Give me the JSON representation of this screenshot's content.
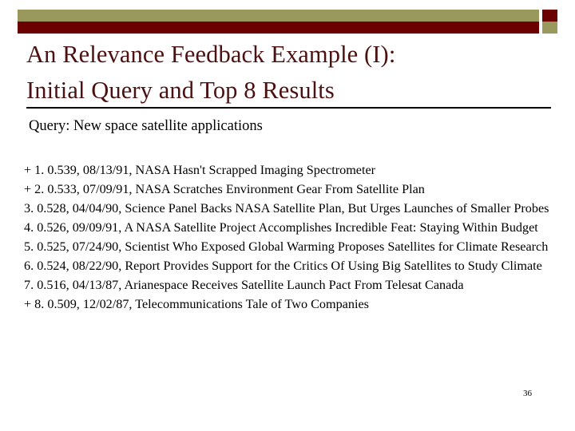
{
  "slide": {
    "title": "An Relevance Feedback Example (I):\nInitial Query and Top 8 Results",
    "title_line_1": "An Relevance Feedback Example (I):",
    "title_line_2": "Initial Query and Top 8 Results",
    "page_number": "36"
  },
  "colors": {
    "accent_olive": "#99995e",
    "accent_dark_red": "#6b0000",
    "title_maroon": "#4b1010",
    "body_text": "#000000",
    "rule": "#000000",
    "background": "#ffffff"
  },
  "query": {
    "label": "Query:",
    "text": "New space satellite applications",
    "full": "Query: New space satellite applications"
  },
  "results": {
    "items": [
      {
        "marker": "+",
        "rank": "1.",
        "score": "0.539",
        "date": "08/13/91",
        "headline": "NASA Hasn't Scrapped Imaging Spectrometer",
        "full": "+ 1. 0.539, 08/13/91, NASA Hasn't Scrapped Imaging Spectrometer"
      },
      {
        "marker": "+",
        "rank": "2.",
        "score": "0.533",
        "date": "07/09/91",
        "headline": "NASA Scratches Environment Gear From Satellite Plan",
        "full": "+ 2. 0.533, 07/09/91, NASA Scratches Environment Gear From Satellite Plan"
      },
      {
        "marker": "",
        "rank": "3.",
        "score": "0.528",
        "date": "04/04/90",
        "headline": "Science Panel Backs NASA Satellite Plan, But Urges Launches of Smaller Probes",
        "full": "3. 0.528, 04/04/90, Science Panel Backs NASA Satellite Plan, But Urges Launches of Smaller Probes"
      },
      {
        "marker": "",
        "rank": "4.",
        "score": "0.526",
        "date": "09/09/91",
        "headline": "A NASA Satellite Project Accomplishes Incredible Feat: Staying Within Budget",
        "full": "4. 0.526, 09/09/91, A NASA Satellite Project Accomplishes Incredible Feat: Staying Within Budget"
      },
      {
        "marker": "",
        "rank": "5.",
        "score": "0.525",
        "date": "07/24/90",
        "headline": "Scientist Who Exposed Global Warming Proposes Satellites for Climate Research",
        "full": "5. 0.525, 07/24/90, Scientist Who Exposed Global Warming Proposes Satellites for Climate Research"
      },
      {
        "marker": "",
        "rank": "6.",
        "score": "0.524",
        "date": "08/22/90",
        "headline": "Report Provides Support for the Critics Of Using Big Satellites to Study Climate",
        "full": "6. 0.524, 08/22/90, Report Provides Support for the Critics Of Using Big Satellites to Study Climate"
      },
      {
        "marker": "",
        "rank": "7.",
        "score": "0.516",
        "date": "04/13/87",
        "headline": "Arianespace Receives Satellite Launch Pact From Telesat Canada",
        "full": "7. 0.516, 04/13/87, Arianespace Receives Satellite Launch Pact From Telesat Canada"
      },
      {
        "marker": "+",
        "rank": "8.",
        "score": "0.509",
        "date": "12/02/87",
        "headline": "Telecommunications Tale of Two Companies",
        "full": "+ 8. 0.509, 12/02/87, Telecommunications Tale of Two Companies"
      }
    ]
  }
}
